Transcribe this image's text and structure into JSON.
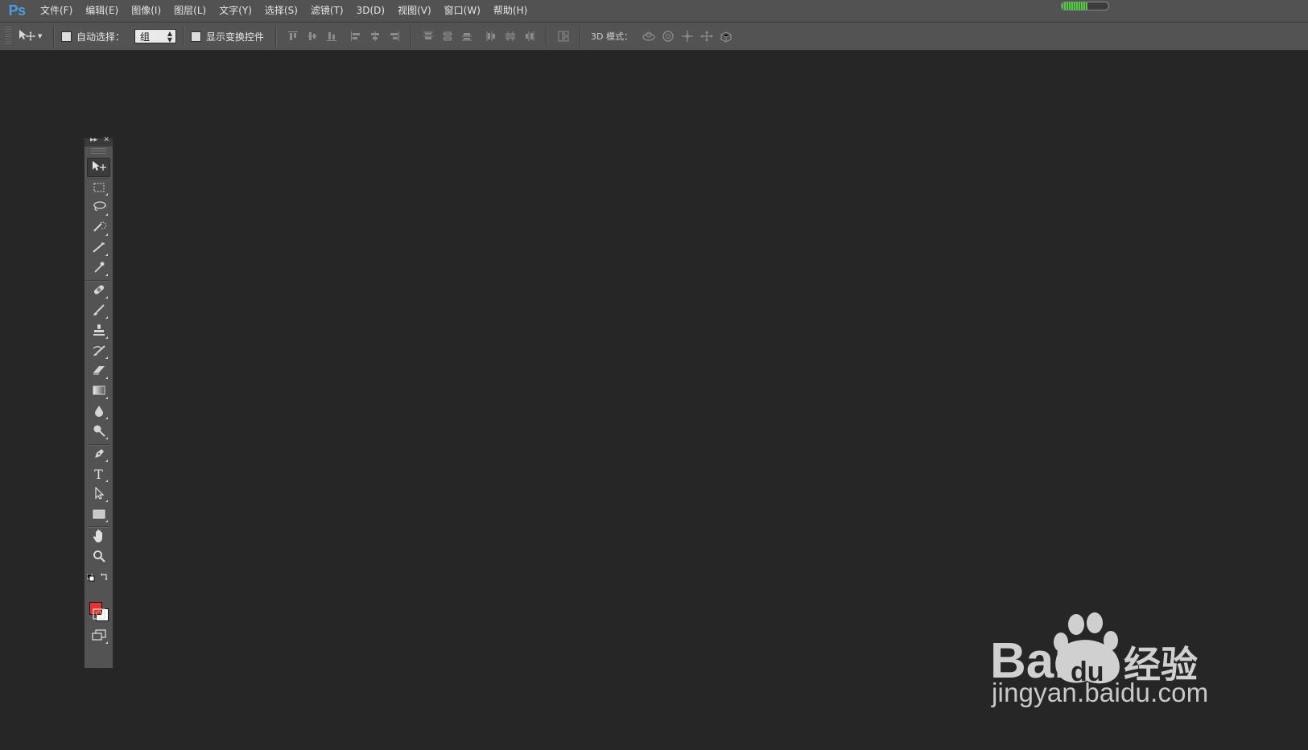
{
  "app": {
    "logo": "Ps"
  },
  "menu": [
    {
      "label": "文件(F)"
    },
    {
      "label": "编辑(E)"
    },
    {
      "label": "图像(I)"
    },
    {
      "label": "图层(L)"
    },
    {
      "label": "文字(Y)"
    },
    {
      "label": "选择(S)"
    },
    {
      "label": "滤镜(T)"
    },
    {
      "label": "3D(D)"
    },
    {
      "label": "视图(V)"
    },
    {
      "label": "窗口(W)"
    },
    {
      "label": "帮助(H)"
    }
  ],
  "status_progress": 0.55,
  "options": {
    "auto_select_label": "自动选择：",
    "auto_select_checked": false,
    "auto_select_value": "组",
    "show_transform_label": "显示变换控件",
    "show_transform_checked": false,
    "mode3d_label": "3D 模式："
  },
  "toolbar": {
    "tools": [
      "move-tool",
      "marquee-tool",
      "lasso-tool",
      "quick-select-tool",
      "crop-tool",
      "eyedropper-tool",
      "healing-brush-tool",
      "brush-tool",
      "clone-stamp-tool",
      "history-brush-tool",
      "eraser-tool",
      "gradient-tool",
      "blur-tool",
      "dodge-tool",
      "pen-tool",
      "type-tool",
      "path-selection-tool",
      "rectangle-tool",
      "hand-tool",
      "zoom-tool"
    ],
    "foreground_color": "#e8322e",
    "background_color": "#ffffff"
  },
  "watermark": {
    "brand": "Bai 经验",
    "url": "jingyan.baidu.com"
  }
}
